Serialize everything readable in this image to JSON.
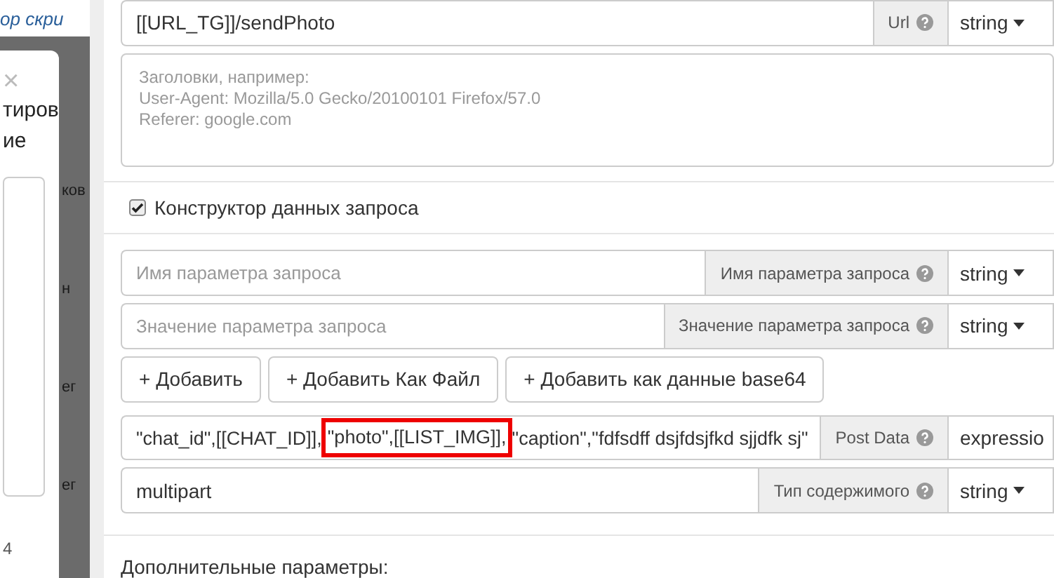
{
  "background": {
    "header_text": "ор скри",
    "behind_texts": [
      "ков",
      "н",
      "ег",
      "ег"
    ]
  },
  "dialog": {
    "close": "×",
    "title_lines": [
      "тиров",
      "ие"
    ],
    "footer": "4"
  },
  "url_row": {
    "value": "[[URL_TG]]/sendPhoto",
    "label": "Url",
    "type": "string"
  },
  "headers": {
    "placeholder": "Заголовки, например:\nUser-Agent: Mozilla/5.0 Gecko/20100101 Firefox/57.0\nReferer: google.com"
  },
  "constructor": {
    "label": "Конструктор данных запроса",
    "checked": true
  },
  "param_rows": [
    {
      "placeholder": "Имя параметра запроса",
      "label": "Имя параметра запроса",
      "type": "string"
    },
    {
      "placeholder": "Значение параметра запроса",
      "label": "Значение параметра запроса",
      "type": "string"
    }
  ],
  "buttons": [
    "+ Добавить",
    "+ Добавить Как Файл",
    "+ Добавить как данные base64"
  ],
  "post_data": {
    "parts": [
      {
        "text": "\"chat_id\",[[CHAT_ID]],",
        "highlighted": false
      },
      {
        "text": "\"photo\",[[LIST_IMG]],",
        "highlighted": true
      },
      {
        "text": "\"caption\",\"fdfsdff dsjfdsjfkd sjjdfk sj\"",
        "highlighted": false
      }
    ],
    "label": "Post Data",
    "type": "expressio"
  },
  "content_type": {
    "value": "multipart",
    "label": "Тип содержимого",
    "type": "string"
  },
  "extra": "Дополнительные параметры:"
}
